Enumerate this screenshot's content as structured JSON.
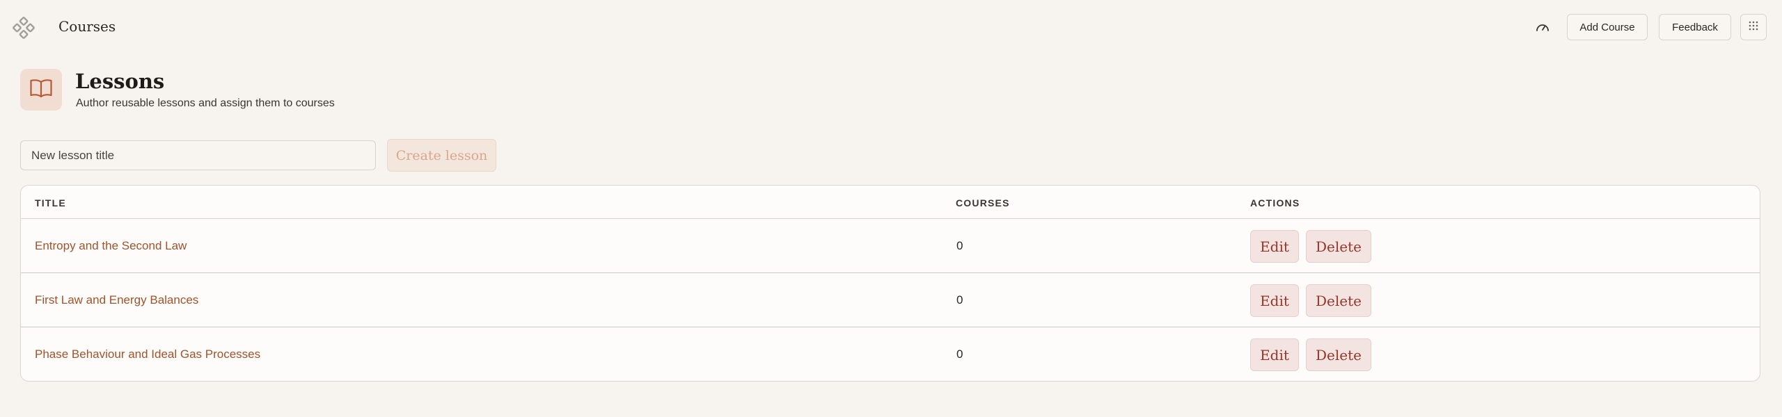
{
  "topbar": {
    "title": "Courses",
    "add_course_label": "Add Course",
    "feedback_label": "Feedback",
    "icons": {
      "logo": "diamond-cluster-icon",
      "speed": "speedometer-icon",
      "grid": "grid-dots-icon"
    }
  },
  "header": {
    "title": "Lessons",
    "subtitle": "Author reusable lessons and assign them to courses",
    "icon": "open-book-icon"
  },
  "create": {
    "placeholder": "New lesson title",
    "value": "",
    "button_label": "Create lesson"
  },
  "table": {
    "headers": {
      "title": "TITLE",
      "courses": "COURSES",
      "actions": "ACTIONS"
    },
    "rows": [
      {
        "title": "Entropy and the Second Law",
        "courses": "0"
      },
      {
        "title": "First Law and Energy Balances",
        "courses": "0"
      },
      {
        "title": "Phase Behaviour and Ideal Gas Processes",
        "courses": "0"
      }
    ],
    "edit_label": "Edit",
    "delete_label": "Delete"
  },
  "colors": {
    "background": "#f7f3ee",
    "accent": "#a3522a",
    "danger": "#9a3428",
    "icon_box": "#f1ddd2"
  }
}
